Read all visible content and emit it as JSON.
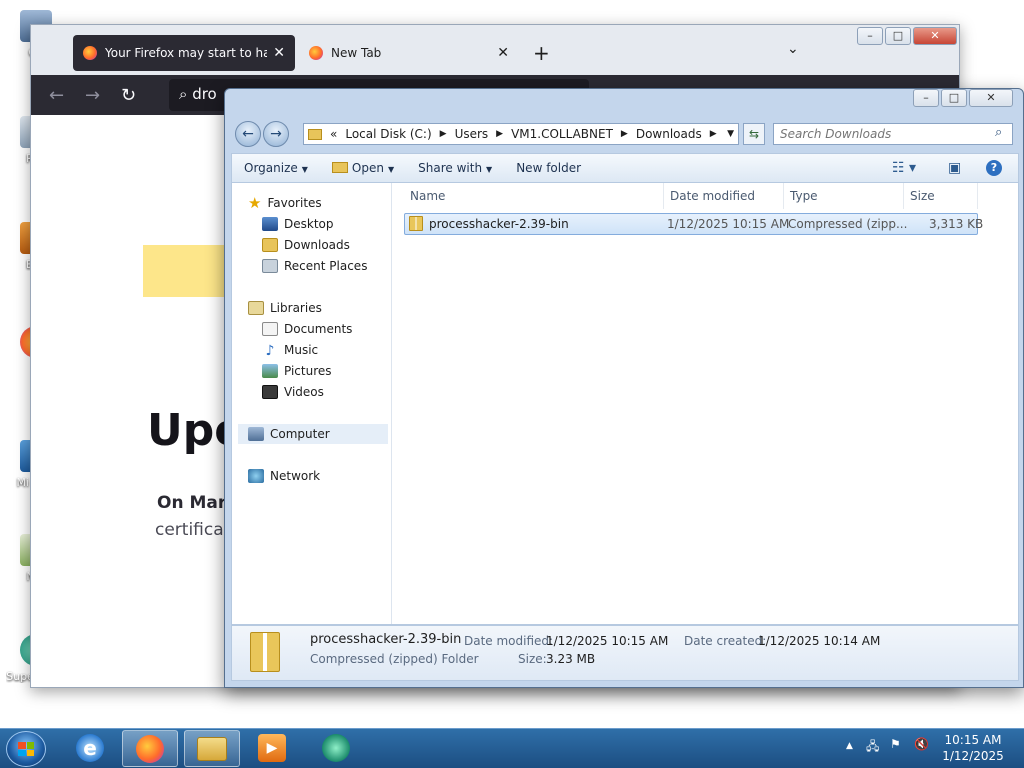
{
  "desktop": {
    "icons": [
      "Go",
      "Rec",
      "Eve",
      "Fi",
      "Mi Visu",
      "Not",
      "Supernium"
    ]
  },
  "firefox": {
    "tabs": [
      {
        "title": "Your Firefox may start to have p",
        "close": "✕"
      },
      {
        "title": "New Tab",
        "close": "✕"
      }
    ],
    "new_tab": "+",
    "tab_list": "⌄",
    "url_text": "dro",
    "page": {
      "heading": "Upc",
      "line1": "On Marc",
      "line2": "certifica"
    }
  },
  "explorer": {
    "breadcrumb": [
      "Local Disk (C:)",
      "Users",
      "VM1.COLLABNET",
      "Downloads"
    ],
    "search_placeholder": "Search Downloads",
    "toolbar": {
      "organize": "Organize",
      "open": "Open",
      "share_with": "Share with",
      "new_folder": "New folder"
    },
    "nav": {
      "favorites": "Favorites",
      "desktop": "Desktop",
      "downloads": "Downloads",
      "recent_places": "Recent Places",
      "libraries": "Libraries",
      "documents": "Documents",
      "music": "Music",
      "pictures": "Pictures",
      "videos": "Videos",
      "computer": "Computer",
      "network": "Network"
    },
    "columns": {
      "name": "Name",
      "date_modified": "Date modified",
      "type": "Type",
      "size": "Size"
    },
    "files": [
      {
        "name": "processhacker-2.39-bin",
        "date_modified": "1/12/2025 10:15 AM",
        "type": "Compressed (zipp...",
        "size": "3,313 KB"
      }
    ],
    "details": {
      "name": "processhacker-2.39-bin",
      "type": "Compressed (zipped) Folder",
      "date_modified_label": "Date modified:",
      "date_modified": "1/12/2025 10:15 AM",
      "date_created_label": "Date created:",
      "date_created": "1/12/2025 10:14 AM",
      "size_label": "Size:",
      "size": "3.23 MB"
    }
  },
  "taskbar": {
    "clock_time": "10:15 AM",
    "clock_date": "1/12/2025"
  },
  "colors": {
    "taskbar": "#1c4e82",
    "selection": "#cfe3f8",
    "firefox_dark": "#2b2a33"
  }
}
